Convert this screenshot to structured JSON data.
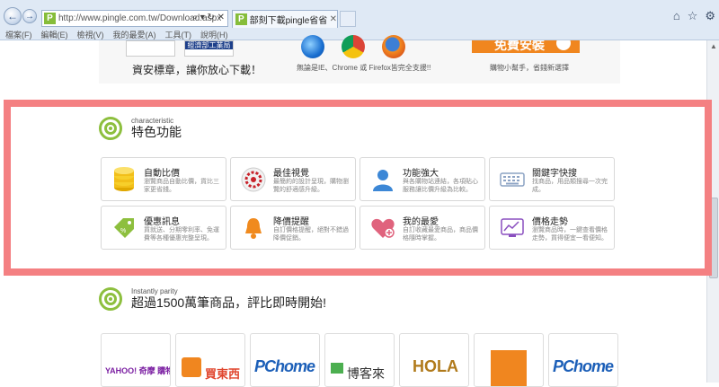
{
  "browser": {
    "address": "http://www.pingle.com.tw/Download.aspx",
    "tab_title": "部刻下載pingle省省吧 | pi...",
    "menu": [
      "檔案(F)",
      "編輯(E)",
      "檢視(V)",
      "我的最愛(A)",
      "工具(T)",
      "說明(H)"
    ]
  },
  "banner": {
    "seal_text": "經濟部工業局",
    "caption_security": "資安標章，讓你放心下載！",
    "caption_browsers": "無論是IE、Chrome 或 Firefox皆完全支援!!",
    "install_label": "免費安裝",
    "caption_install": "購物小幫手，省錢新選擇"
  },
  "characteristic": {
    "sub": "characteristic",
    "title": "特色功能"
  },
  "features": [
    {
      "title": "自動比價",
      "desc": "瀏覽商品自動比價，貨比三家更省錢。",
      "icon": "coins-icon"
    },
    {
      "title": "最佳視覺",
      "desc": "最簡約的設計呈現，購物瀏覽的舒適感升級。",
      "icon": "aperture-icon"
    },
    {
      "title": "功能強大",
      "desc": "與各購物站連結，各項貼心服務讓比價升級為比較。",
      "icon": "user-icon"
    },
    {
      "title": "關鍵字快搜",
      "desc": "找商品，用品類搜尋一次完成。",
      "icon": "keyboard-icon"
    },
    {
      "title": "優惠訊息",
      "desc": "買就送、分期零利率、免運費等各種優惠完整呈現。",
      "icon": "tag-icon"
    },
    {
      "title": "降價提醒",
      "desc": "自訂價格提醒，絕對不錯過降價促銷。",
      "icon": "bell-icon"
    },
    {
      "title": "我的最愛",
      "desc": "自訂收藏最愛商品，商品價格隨時掌握。",
      "icon": "heart-icon"
    },
    {
      "title": "價格走勢",
      "desc": "瀏覽商品時，一鍵查看價格走勢，買得便宜一看便知。",
      "icon": "chart-icon"
    }
  ],
  "instantly": {
    "sub": "Instantly parity",
    "title": "超過1500萬筆商品，評比即時開始!"
  },
  "brands": [
    {
      "name": "YAHOO! 奇摩 購物中心"
    },
    {
      "name": "買東西"
    },
    {
      "name": "PChome ONLINE"
    },
    {
      "name": "博客來"
    },
    {
      "name": "HOLA"
    },
    {
      "name": ""
    },
    {
      "name": "PChome ONLINE"
    }
  ],
  "colors": {
    "accent_green": "#8dbf3e",
    "highlight_pink": "#f48082",
    "install_orange": "#f0861f"
  }
}
